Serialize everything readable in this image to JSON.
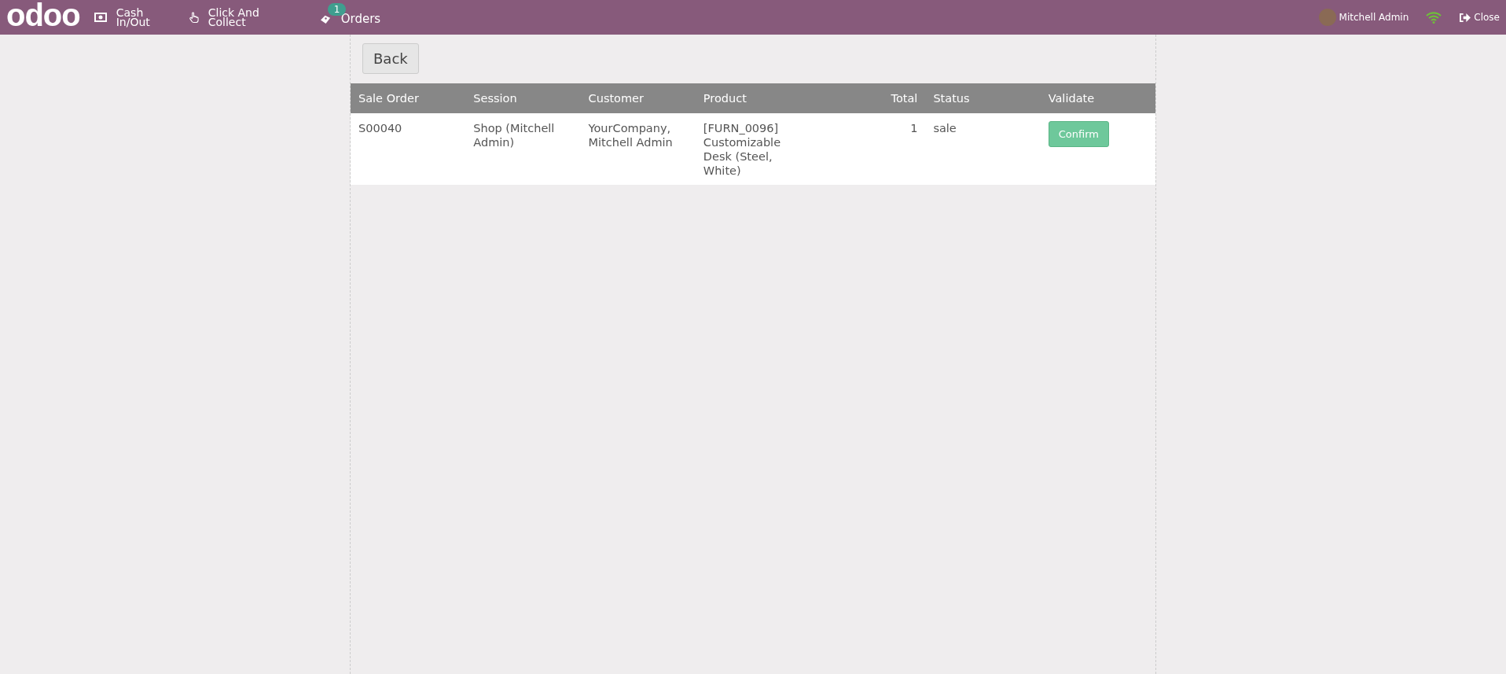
{
  "navbar": {
    "logo": "odoo",
    "items": [
      {
        "kind": "cash",
        "label": "Cash In/Out"
      },
      {
        "kind": "collect",
        "label": "Click And Collect"
      },
      {
        "kind": "orders",
        "label": "Orders",
        "badge": "1"
      }
    ],
    "user": "Mitchell Admin",
    "close": "Close"
  },
  "back_button": "Back",
  "table": {
    "columns": [
      {
        "label": "Sale Order",
        "kind": "text"
      },
      {
        "label": "Session",
        "kind": "text"
      },
      {
        "label": "Customer",
        "kind": "text"
      },
      {
        "label": "Product",
        "kind": "text"
      },
      {
        "label": "Total",
        "kind": "number"
      },
      {
        "label": "Status",
        "kind": "text"
      },
      {
        "label": "Validate",
        "kind": "text"
      }
    ],
    "rows": [
      {
        "cells": [
          "S00040",
          "Shop (Mitchell Admin)",
          "YourCompany, Mitchell Admin",
          "[FURN_0096] Customizable Desk (Steel, White)",
          "1",
          "sale"
        ],
        "action": "Confirm"
      }
    ]
  }
}
